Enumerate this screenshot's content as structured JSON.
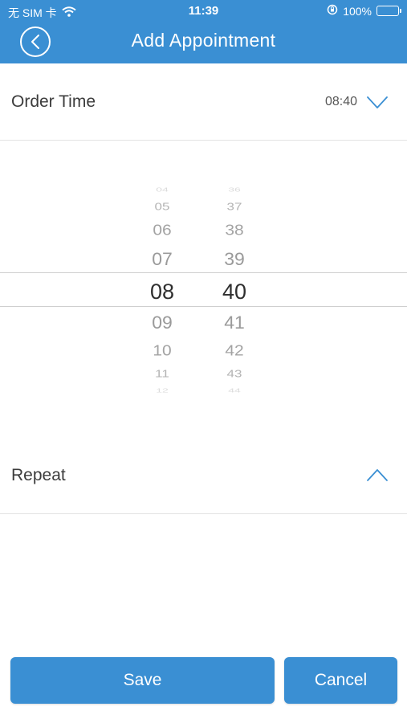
{
  "status_bar": {
    "carrier": "无 SIM 卡",
    "time": "11:39",
    "battery_text": "100%"
  },
  "nav": {
    "title": "Add Appointment"
  },
  "order_time": {
    "label": "Order Time",
    "value": "08:40"
  },
  "picker": {
    "hours": [
      "04",
      "05",
      "06",
      "07",
      "08",
      "09",
      "10",
      "11",
      "12"
    ],
    "minutes": [
      "36",
      "37",
      "38",
      "39",
      "40",
      "41",
      "42",
      "43",
      "44"
    ],
    "selected_hour": "08",
    "selected_minute": "40"
  },
  "repeat": {
    "label": "Repeat"
  },
  "buttons": {
    "save": "Save",
    "cancel": "Cancel"
  },
  "colors": {
    "accent": "#3a8fd3",
    "divider": "#e3e3e3"
  }
}
